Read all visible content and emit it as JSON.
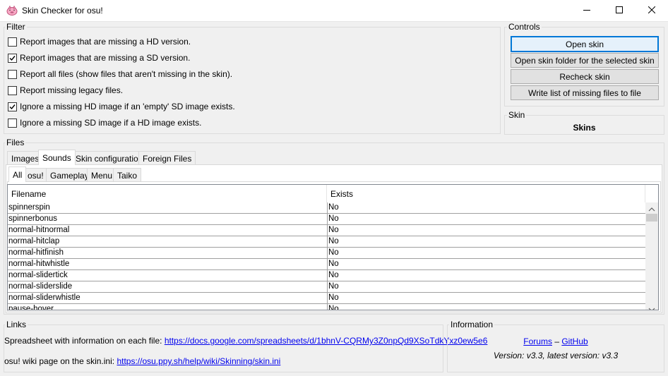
{
  "window": {
    "title": "Skin Checker for osu!"
  },
  "filter": {
    "label": "Filter",
    "options": [
      {
        "label": "Report images that are missing a HD version.",
        "checked": false
      },
      {
        "label": "Report images that are missing a SD version.",
        "checked": true
      },
      {
        "label": "Report all files (show files that aren't missing in the skin).",
        "checked": false
      },
      {
        "label": "Report missing legacy files.",
        "checked": false
      },
      {
        "label": "Ignore a missing HD image if an 'empty' SD image exists.",
        "checked": true
      },
      {
        "label": "Ignore a missing SD image if a HD image exists.",
        "checked": false
      }
    ]
  },
  "controls": {
    "label": "Controls",
    "buttons": [
      "Open skin",
      "Open skin folder for the selected skin",
      "Recheck skin",
      "Write list of missing files to file"
    ]
  },
  "skin": {
    "label": "Skin",
    "name": "Skins"
  },
  "files": {
    "label": "Files",
    "tabs": [
      "Images",
      "Sounds",
      "Skin configuration",
      "Foreign Files"
    ],
    "active_tab": "Sounds",
    "subtabs": [
      "All",
      "osu!",
      "Gameplay",
      "Menu",
      "Taiko"
    ],
    "active_subtab": "All",
    "columns": [
      "Filename",
      "Exists"
    ],
    "rows": [
      [
        "spinnerspin",
        "No"
      ],
      [
        "spinnerbonus",
        "No"
      ],
      [
        "normal-hitnormal",
        "No"
      ],
      [
        "normal-hitclap",
        "No"
      ],
      [
        "normal-hitfinish",
        "No"
      ],
      [
        "normal-hitwhistle",
        "No"
      ],
      [
        "normal-slidertick",
        "No"
      ],
      [
        "normal-sliderslide",
        "No"
      ],
      [
        "normal-sliderwhistle",
        "No"
      ],
      [
        "pause-hover",
        "No"
      ]
    ]
  },
  "links": {
    "label": "Links",
    "spreadsheet_text": "Spreadsheet with information on each file:",
    "spreadsheet_url": "https://docs.google.com/spreadsheets/d/1bhnV-CQRMy3Z0npQd9XSoTdkYxz0ew5e6",
    "wiki_text": "osu! wiki page on the skin.ini:",
    "wiki_url": "https://osu.ppy.sh/help/wiki/Skinning/skin.ini"
  },
  "information": {
    "label": "Information",
    "forums": "Forums",
    "separator": "–",
    "github": "GitHub",
    "version": "Version: v3.3, latest version: v3.3"
  },
  "icons": {
    "app": "pig-icon",
    "minimize": "minimize-icon",
    "maximize": "maximize-icon",
    "close": "close-icon"
  }
}
